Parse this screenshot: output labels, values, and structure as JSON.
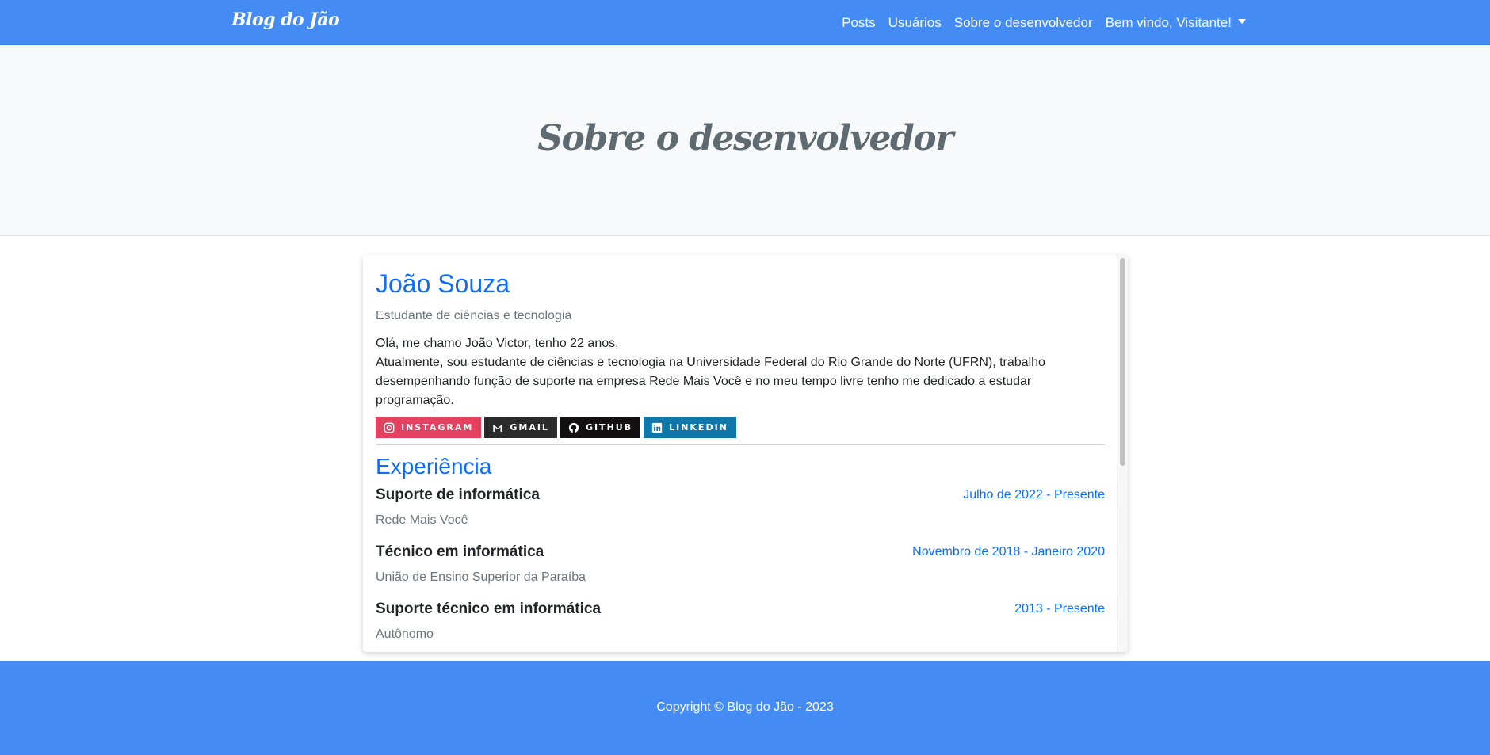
{
  "navbar": {
    "brand": "Blog do Jão",
    "links": [
      "Posts",
      "Usuários",
      "Sobre o desenvolvedor"
    ],
    "user_menu": "Bem vindo, Visitante!"
  },
  "hero": {
    "title": "Sobre o desenvolvedor"
  },
  "profile": {
    "name": "João Souza",
    "subtitle": "Estudante de ciências e tecnologia",
    "bio_line1": "Olá, me chamo João Victor, tenho 22 anos.",
    "bio_line2": "Atualmente, sou estudante de ciências e tecnologia na Universidade Federal do Rio Grande do Norte (UFRN), trabalho desempenhando função de suporte na empresa Rede Mais Você e no meu tempo livre tenho me dedicado a estudar programação.",
    "socials": [
      {
        "label": "Instagram",
        "icon": "instagram-icon",
        "color": "#e4405f"
      },
      {
        "label": "Gmail",
        "icon": "gmail-icon",
        "color": "#2b2b2b"
      },
      {
        "label": "GitHub",
        "icon": "github-icon",
        "color": "#121011"
      },
      {
        "label": "LinkedIn",
        "icon": "linkedin-icon",
        "color": "#0e76a8"
      }
    ]
  },
  "experience": {
    "title": "Experiência",
    "items": [
      {
        "title": "Suporte de informática",
        "date": "Julho de 2022 - Presente",
        "org": "Rede Mais Você"
      },
      {
        "title": "Técnico em informática",
        "date": "Novembro de 2018 - Janeiro 2020",
        "org": "União de Ensino Superior da Paraíba"
      },
      {
        "title": "Suporte técnico em informática",
        "date": "2013 - Presente",
        "org": "Autônomo"
      }
    ]
  },
  "footer": {
    "copyright": "Copyright © Blog do Jão - 2023"
  },
  "colors": {
    "primary": "#448cf4",
    "accent": "#0d6efd",
    "muted": "#6c757d"
  }
}
